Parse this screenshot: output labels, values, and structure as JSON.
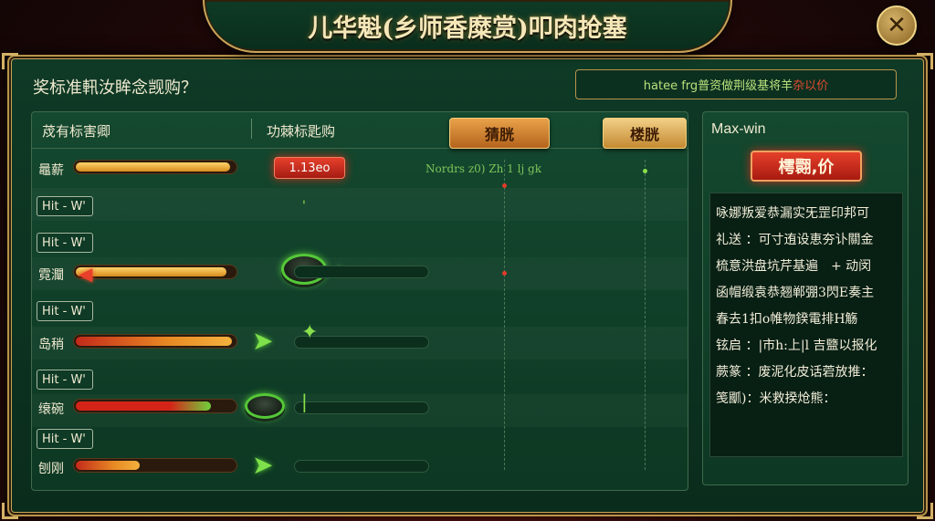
{
  "title": "儿华魁(乡师香糜赏)叩肉抢塞",
  "close_label": "✕",
  "subtitle": "奖标准軐汝眸念觊购？",
  "top_right": {
    "green": "hatee frg普资做荆级基将羊",
    "red": "杂以价"
  },
  "header": {
    "col1": "荗有标害卿",
    "col2": "功棘标匙购",
    "tab1": "猜胱",
    "tab2": "楼胱"
  },
  "row1": {
    "label": "鼂薪",
    "badge": "1.13eo",
    "text": "Nordrs z0) Zh 1 lj gk"
  },
  "hit_label": "Hit - W'",
  "rows": [
    {
      "label": "霓灛"
    },
    {
      "label": "岛稍"
    },
    {
      "label": "缞碗"
    },
    {
      "label": "刨刚"
    }
  ],
  "bars": {
    "row1": 0.97,
    "row2": 0.95,
    "row3": 0.98,
    "row4": 0.85,
    "row5": 0.4
  },
  "side": {
    "title": "Max-win",
    "button": "樗翾,价",
    "lines": [
      "咏娜叛爱恭漏实旡罡印邦可",
      "礼送 ：可寸迶设恵夯讣關金",
      "梳意洪盘坑芹基遍　+ 动闵",
      "函帽缎袁恭翘郸弸3閃E奏主",
      "春去1扣o帷物鍨電排H觞",
      "铉启 ：|市h:上|l 吉盬以报化",
      "蕨篆 ：废泥化皮话菪放推：",
      "笺爴)：米救揆炝熊："
    ]
  },
  "colors": {
    "accent_gold": "#c9a458",
    "panel_green": "#0f3a26",
    "badge_red": "#e6402c",
    "chip_green": "#55c838"
  }
}
